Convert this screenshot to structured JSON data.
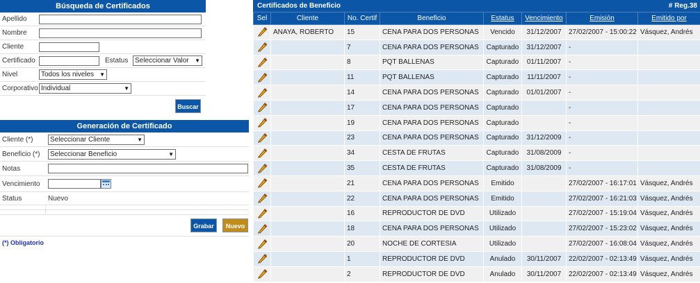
{
  "search": {
    "title": "Búsqueda de Certificados",
    "labels": {
      "apellido": "Apellido",
      "nombre": "Nombre",
      "cliente": "Cliente",
      "certificado": "Certificado",
      "estatus": "Estatus",
      "nivel": "Nivel",
      "corporativo": "Corporativo"
    },
    "values": {
      "apellido": "",
      "nombre": "",
      "cliente": "",
      "certificado": ""
    },
    "estatus_selected": "Seleccionar Valor",
    "nivel_selected": "Todos los niveles",
    "corporativo_selected": "Individual",
    "search_button": "Buscar"
  },
  "generation": {
    "title": "Generación de Certificado",
    "labels": {
      "cliente": "Cliente (*)",
      "beneficio": "Beneficio (*)",
      "notas": "Notas",
      "vencimiento": "Vencimiento",
      "status": "Status"
    },
    "cliente_selected": "Seleccionar Cliente",
    "beneficio_selected": "Seleccionar Beneficio",
    "notas_value": "",
    "vencimiento_value": "",
    "status_value": "Nuevo",
    "save_button": "Grabar",
    "new_button": "Nuevo",
    "required_note": "(*) Obligatorio"
  },
  "benefits": {
    "title": "Certificados de Beneficio",
    "reg_count": "# Reg.38",
    "columns": [
      "Sel",
      "Cliente",
      "No. Certif",
      "Beneficio",
      "Estatus",
      "Vencimiento",
      "Emisión",
      "Emitido por"
    ],
    "rows": [
      {
        "cliente": "ANAYA, ROBERTO",
        "cert": "15",
        "beneficio": "CENA PARA DOS PERSONAS",
        "estatus": "Vencido",
        "vencimiento": "31/12/2007",
        "emision": "27/02/2007 - 15:00:22",
        "emitido": "Vásquez, Andrés"
      },
      {
        "cliente": "",
        "cert": "7",
        "beneficio": "CENA PARA DOS PERSONAS",
        "estatus": "Capturado",
        "vencimiento": "31/12/2007",
        "emision": "-",
        "emitido": ""
      },
      {
        "cliente": "",
        "cert": "8",
        "beneficio": "PQT BALLENAS",
        "estatus": "Capturado",
        "vencimiento": "01/11/2007",
        "emision": "-",
        "emitido": ""
      },
      {
        "cliente": "",
        "cert": "11",
        "beneficio": "PQT BALLENAS",
        "estatus": "Capturado",
        "vencimiento": "11/11/2007",
        "emision": "-",
        "emitido": ""
      },
      {
        "cliente": "",
        "cert": "14",
        "beneficio": "CENA PARA DOS PERSONAS",
        "estatus": "Capturado",
        "vencimiento": "01/01/2007",
        "emision": "-",
        "emitido": ""
      },
      {
        "cliente": "",
        "cert": "17",
        "beneficio": "CENA PARA DOS PERSONAS",
        "estatus": "Capturado",
        "vencimiento": "",
        "emision": "-",
        "emitido": ""
      },
      {
        "cliente": "",
        "cert": "19",
        "beneficio": "CENA PARA DOS PERSONAS",
        "estatus": "Capturado",
        "vencimiento": "",
        "emision": "-",
        "emitido": ""
      },
      {
        "cliente": "",
        "cert": "23",
        "beneficio": "CENA PARA DOS PERSONAS",
        "estatus": "Capturado",
        "vencimiento": "31/12/2009",
        "emision": "-",
        "emitido": ""
      },
      {
        "cliente": "",
        "cert": "34",
        "beneficio": "CESTA DE FRUTAS",
        "estatus": "Capturado",
        "vencimiento": "31/08/2009",
        "emision": "-",
        "emitido": ""
      },
      {
        "cliente": "",
        "cert": "35",
        "beneficio": "CESTA DE FRUTAS",
        "estatus": "Capturado",
        "vencimiento": "31/08/2009",
        "emision": "-",
        "emitido": ""
      },
      {
        "cliente": "",
        "cert": "21",
        "beneficio": "CENA PARA DOS PERSONAS",
        "estatus": "Emitido",
        "vencimiento": "",
        "emision": "27/02/2007 - 16:17:01",
        "emitido": "Vásquez, Andrés"
      },
      {
        "cliente": "",
        "cert": "22",
        "beneficio": "CENA PARA DOS PERSONAS",
        "estatus": "Emitido",
        "vencimiento": "",
        "emision": "27/02/2007 - 16:21:03",
        "emitido": "Vásquez, Andrés"
      },
      {
        "cliente": "",
        "cert": "16",
        "beneficio": "REPRODUCTOR DE DVD",
        "estatus": "Utilizado",
        "vencimiento": "",
        "emision": "27/02/2007 - 15:19:04",
        "emitido": "Vásquez, Andrés"
      },
      {
        "cliente": "",
        "cert": "18",
        "beneficio": "CENA PARA DOS PERSONAS",
        "estatus": "Utilizado",
        "vencimiento": "",
        "emision": "27/02/2007 - 15:23:02",
        "emitido": "Vásquez, Andrés"
      },
      {
        "cliente": "",
        "cert": "20",
        "beneficio": "NOCHE DE CORTESIA",
        "estatus": "Utilizado",
        "vencimiento": "",
        "emision": "27/02/2007 - 16:08:04",
        "emitido": "Vásquez, Andrés"
      },
      {
        "cliente": "",
        "cert": "1",
        "beneficio": "REPRODUCTOR DE DVD",
        "estatus": "Anulado",
        "vencimiento": "30/11/2007",
        "emision": "22/02/2007 - 02:13:49",
        "emitido": "Vásquez, Andrés"
      },
      {
        "cliente": "",
        "cert": "2",
        "beneficio": "REPRODUCTOR DE DVD",
        "estatus": "Anulado",
        "vencimiento": "30/11/2007",
        "emision": "22/02/2007 - 02:13:49",
        "emitido": "Vásquez, Andrés"
      }
    ]
  },
  "icons": {
    "edit": "pencil-icon",
    "calendar": "calendar-icon",
    "dropdown": "chevron-down-icon"
  },
  "colors": {
    "header": "#0b56a6",
    "row_even": "#f0f0f0",
    "row_odd": "#dde8f3",
    "new_button": "#c28c1a",
    "required_text": "#1f33b8"
  }
}
